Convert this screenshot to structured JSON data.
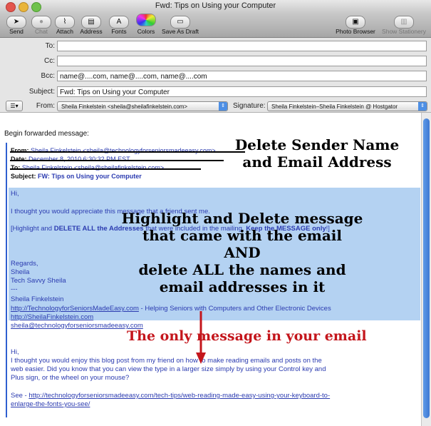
{
  "window": {
    "title": "Fwd: Tips on Using your Computer"
  },
  "toolbar": {
    "send": {
      "label": "Send",
      "icon": "send-icon"
    },
    "chat": {
      "label": "Chat",
      "icon": "chat-icon"
    },
    "attach": {
      "label": "Attach",
      "icon": "paperclip-icon"
    },
    "address": {
      "label": "Address",
      "icon": "address-book-icon"
    },
    "fonts": {
      "label": "Fonts",
      "icon": "fonts-icon"
    },
    "colors": {
      "label": "Colors",
      "icon": "color-wheel-icon"
    },
    "draft": {
      "label": "Save As Draft",
      "icon": "save-draft-icon"
    },
    "photo": {
      "label": "Photo Browser",
      "icon": "photo-browser-icon"
    },
    "stationery": {
      "label": "Show Stationery",
      "icon": "stationery-icon"
    }
  },
  "header": {
    "to": {
      "label": "To:",
      "value": ""
    },
    "cc": {
      "label": "Cc:",
      "value": ""
    },
    "bcc": {
      "label": "Bcc:",
      "value": "name@....com, name@....com, name@....com"
    },
    "subject": {
      "label": "Subject:",
      "value": "Fwd: Tips on Using your Computer"
    },
    "from": {
      "label": "From:",
      "value": "Sheila Finkelstein <sheila@sheilafinkelstein.com>"
    },
    "signature": {
      "label": "Signature:",
      "value": "Sheila Finkelstein–Sheila Finkelstein @ Hostgator"
    }
  },
  "message": {
    "begin": "Begin forwarded message:",
    "from_label": "From:",
    "from_value": "Sheila Finkelstein <sheila@technologyforseniorsmadeeasy.com>",
    "date_label": "Date:",
    "date_value": "December 8, 2010 6:30:32 PM EST",
    "to_label": "To:",
    "to_value": "Sheila Finkelstein <sheila@sheilafinkelstein.com>",
    "subject_label": "Subject:",
    "subject_value": "FW: Tips on Using your Computer",
    "hi1": "Hi,",
    "line1": "I thought you would appreciate this message that a friend sent me.",
    "line2_a": "[Highlight and ",
    "line2_b": "DELETE ALL the Addresses",
    "line2_c": " that were included in the mailing. ",
    "line2_d": "Keep the MESSAGE only",
    "line2_e": "!]",
    "regards": "Regards,",
    "sig_name": "Sheila",
    "sig_title": "Tech Savvy Sheila",
    "sig_dash": "---",
    "sig_full": "Sheila Finkelstein",
    "sig_link1": "http://TechnologyforSeniorsMadeEasy.com",
    "sig_link1_tail": " - Helping Seniors with Computers and Other Electronic Devices",
    "sig_link2": "http://SheilaFinkelstein.com",
    "sig_link3": "sheila@technologyforseniorsmadeeasy.com",
    "hi2": "Hi,",
    "body1": "I thought you would enjoy this blog post from my friend on how to make reading emails and posts on the",
    "body2": "web easier.  Did you know that you can view the type in a larger size simply by using your Control key and",
    "body3": "Plus sign, or the wheel on your mouse?",
    "see": "See - ",
    "see_link1": "http://technologyforseniorsmadeeasy.com/tech-tips/web-reading-made-easy-using-your-keyboard-to-",
    "see_link2": "enlarge-the-fonts-you-see/"
  },
  "annotations": {
    "delete_sender_1": "Delete Sender Name",
    "delete_sender_2": "and Email Address",
    "highlight_1": "Highlight and Delete message",
    "highlight_2": "that came with the email",
    "highlight_3": "AND",
    "highlight_4": "delete ALL the names and",
    "highlight_5": "email addresses in it",
    "only_message": "The only message in your email"
  },
  "colors": {
    "annotation_red": "#c4161c",
    "highlight": "#b4d2f2",
    "quote_blue": "#2b3bb0"
  }
}
